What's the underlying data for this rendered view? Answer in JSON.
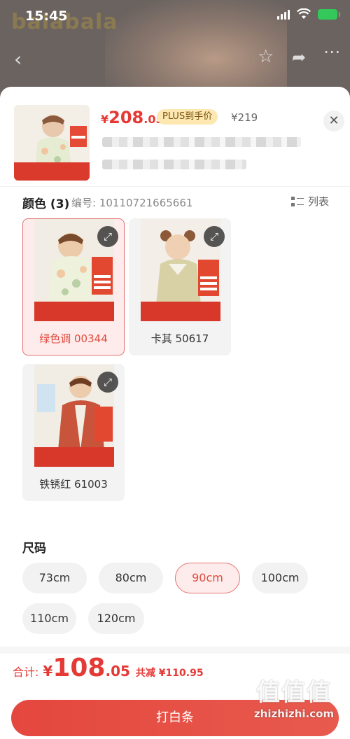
{
  "status_bar": {
    "time": "15:45"
  },
  "background": {
    "brand": "balabala"
  },
  "header": {
    "price_currency": "¥",
    "price_int": "208",
    "price_dec": ".05",
    "plus_label": "PLUS到手价",
    "original_price": "¥219",
    "close_label": "✕"
  },
  "color_section": {
    "title": "颜色 (3)",
    "sku": "编号: 10110721665661",
    "list_label": "列表",
    "options": [
      {
        "label": "绿色调 00344",
        "selected": true
      },
      {
        "label": "卡其 50617",
        "selected": false
      },
      {
        "label": "铁锈红 61003",
        "selected": false
      }
    ]
  },
  "size_section": {
    "title": "尺码",
    "options": [
      {
        "label": "73cm",
        "selected": false
      },
      {
        "label": "80cm",
        "selected": false
      },
      {
        "label": "90cm",
        "selected": true
      },
      {
        "label": "100cm",
        "selected": false
      },
      {
        "label": "110cm",
        "selected": false
      },
      {
        "label": "120cm",
        "selected": false
      }
    ]
  },
  "footer": {
    "total_label": "合计:",
    "total_currency": "¥",
    "total_int": "108",
    "total_dec": ".05",
    "savings": "共减 ¥110.95",
    "button_label": "打白条"
  },
  "watermark": {
    "glyphs": "值值值",
    "site": "zhizhizhi.com"
  },
  "colors": {
    "accent": "#e53935",
    "selected_bg": "#fdeceb",
    "plus_badge": "#fce8b0"
  }
}
